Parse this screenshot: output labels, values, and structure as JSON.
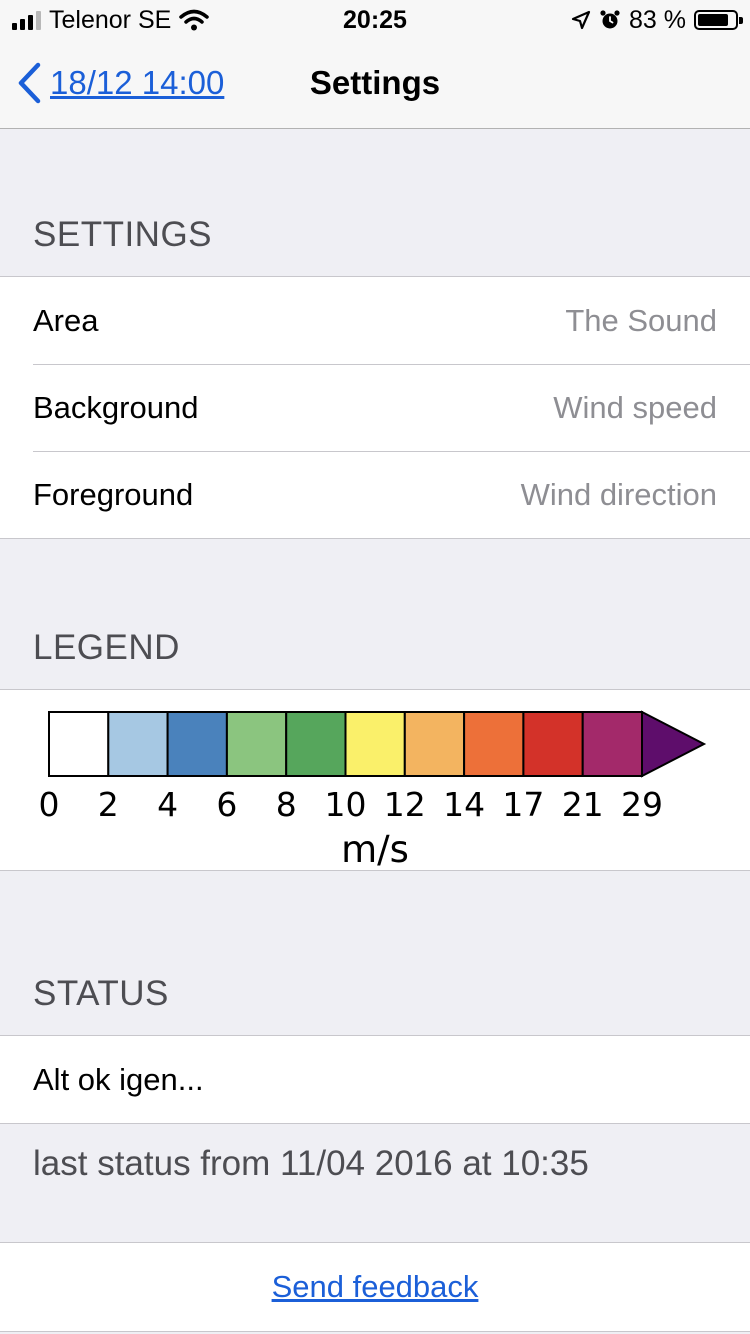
{
  "status_bar": {
    "carrier": "Telenor SE",
    "time": "20:25",
    "battery": "83 %",
    "battery_level": 0.83
  },
  "nav": {
    "back_label": "18/12 14:00",
    "title": "Settings"
  },
  "settings": {
    "header": "SETTINGS",
    "rows": [
      {
        "label": "Area",
        "value": "The Sound"
      },
      {
        "label": "Background",
        "value": "Wind speed"
      },
      {
        "label": "Foreground",
        "value": "Wind direction"
      }
    ]
  },
  "legend": {
    "header": "LEGEND",
    "unit": "m/s",
    "ticks": [
      "0",
      "2",
      "4",
      "6",
      "8",
      "10",
      "12",
      "14",
      "17",
      "21",
      "29"
    ],
    "colors": [
      "#ffffff",
      "#a6c8e3",
      "#4a82bc",
      "#8bc57f",
      "#56a65c",
      "#faf06a",
      "#f3b460",
      "#ed7039",
      "#d33229",
      "#a3296a",
      "#5e0d6b"
    ]
  },
  "status": {
    "header": "STATUS",
    "text": "Alt ok igen...",
    "last_status": "last status from 11/04 2016 at 10:35"
  },
  "feedback": {
    "label": "Send feedback"
  },
  "theme": {
    "accent": "#1b5fd8",
    "background": "#efeff4"
  }
}
